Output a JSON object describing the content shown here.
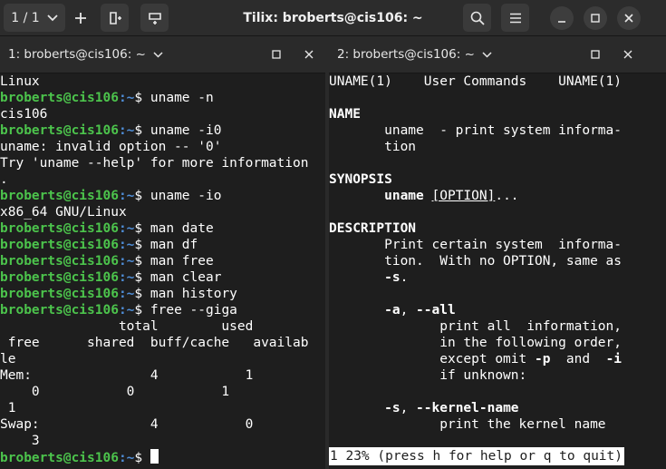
{
  "window": {
    "title": "Tilix: broberts@cis106: ~",
    "session_label": "1 / 1"
  },
  "icons": {
    "session_dropdown": "chevron-down-icon",
    "add_terminal": "plus-icon",
    "split_horizontal": "add-terminal-right-icon",
    "split_vertical": "add-terminal-down-icon",
    "search": "search-icon",
    "menu": "hamburger-menu-icon",
    "minimize": "minimize-icon",
    "maximize": "maximize-icon",
    "close": "close-icon"
  },
  "left_pane": {
    "title": "1: broberts@cis106: ~",
    "lines": [
      {
        "text": "Linux"
      },
      {
        "user": "broberts@cis106",
        "path": ":~",
        "cmd": "$ uname -n"
      },
      {
        "text": "cis106"
      },
      {
        "user": "broberts@cis106",
        "path": ":~",
        "cmd": "$ uname -i0"
      },
      {
        "text": "uname: invalid option -- '0'"
      },
      {
        "text": "Try 'uname --help' for more information"
      },
      {
        "text": "."
      },
      {
        "user": "broberts@cis106",
        "path": ":~",
        "cmd": "$ uname -io"
      },
      {
        "text": "x86_64 GNU/Linux"
      },
      {
        "user": "broberts@cis106",
        "path": ":~",
        "cmd": "$ man date"
      },
      {
        "user": "broberts@cis106",
        "path": ":~",
        "cmd": "$ man df"
      },
      {
        "user": "broberts@cis106",
        "path": ":~",
        "cmd": "$ man free"
      },
      {
        "user": "broberts@cis106",
        "path": ":~",
        "cmd": "$ man clear"
      },
      {
        "user": "broberts@cis106",
        "path": ":~",
        "cmd": "$ man history"
      },
      {
        "user": "broberts@cis106",
        "path": ":~",
        "cmd": "$ free --giga"
      },
      {
        "text": "               total        used"
      },
      {
        "text": " free      shared  buff/cache   availab"
      },
      {
        "text": "le"
      },
      {
        "text": "Mem:               4           1"
      },
      {
        "text": "    0           0           1"
      },
      {
        "text": " 1"
      },
      {
        "text": "Swap:              4           0"
      },
      {
        "text": "    3"
      },
      {
        "user": "broberts@cis106",
        "path": ":~",
        "cmd": "$ ",
        "cursor": true
      }
    ]
  },
  "right_pane": {
    "title": "2: broberts@cis106: ~",
    "lines": [
      {
        "text": "UNAME(1)    User Commands    UNAME(1)"
      },
      {
        "text": ""
      },
      {
        "bold": "NAME"
      },
      {
        "text": "       uname  - print system informa-"
      },
      {
        "text": "       tion"
      },
      {
        "text": ""
      },
      {
        "bold": "SYNOPSIS"
      },
      {
        "indent": "       ",
        "bold_part": "uname",
        "mid": " ",
        "under_part": "[OPTION]",
        "rest": "..."
      },
      {
        "text": ""
      },
      {
        "bold": "DESCRIPTION"
      },
      {
        "text": "       Print certain system  informa-"
      },
      {
        "text": "       tion.  With no OPTION, same as"
      },
      {
        "indent": "       ",
        "bold_part": "-s",
        "rest": "."
      },
      {
        "text": ""
      },
      {
        "indent": "       ",
        "bold_part": "-a",
        "rest": ", ",
        "bold_part2": "--all"
      },
      {
        "text": "              print all  information,"
      },
      {
        "text": "              in the following order,"
      },
      {
        "indent": "              ",
        "pre": "except omit ",
        "bold_part": "-p",
        "rest": "  and  ",
        "bold_part2": "-i"
      },
      {
        "text": "              if unknown:"
      },
      {
        "text": ""
      },
      {
        "indent": "       ",
        "bold_part": "-s",
        "rest": ", ",
        "bold_part2": "--kernel-name"
      },
      {
        "text": "              print the kernel name"
      }
    ],
    "status": "1 23% (press h for help or q to quit)"
  }
}
